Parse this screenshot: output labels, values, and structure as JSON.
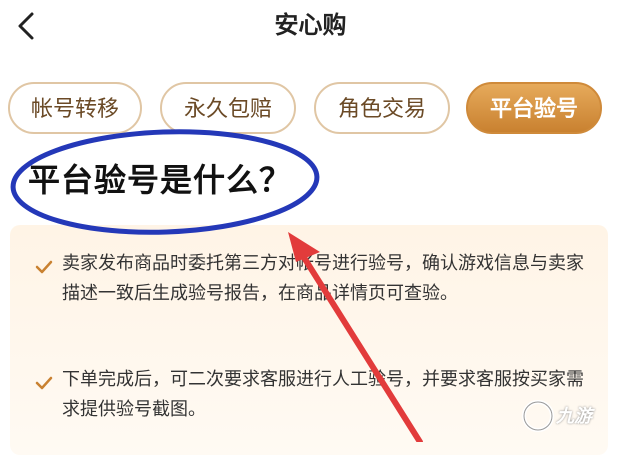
{
  "nav": {
    "title": "安心购"
  },
  "tabs": [
    {
      "label": "帐号转移",
      "active": false
    },
    {
      "label": "永久包赔",
      "active": false
    },
    {
      "label": "角色交易",
      "active": false
    },
    {
      "label": "平台验号",
      "active": true
    }
  ],
  "section": {
    "heading": "平台验号是什么？"
  },
  "items": [
    {
      "text": "卖家发布商品时委托第三方对帐号进行验号，确认游戏信息与卖家描述一致后生成验号报告，在商品详情页可查验。"
    },
    {
      "text": "下单完成后，可二次要求客服进行人工验号，并要求客服按买家需求提供验号截图。"
    }
  ],
  "watermark": {
    "text": "九游"
  },
  "colors": {
    "accent": "#d08a37",
    "tab_border": "#e0c6a4",
    "annotation_blue": "#2438b8",
    "annotation_red": "#e23b3b"
  }
}
